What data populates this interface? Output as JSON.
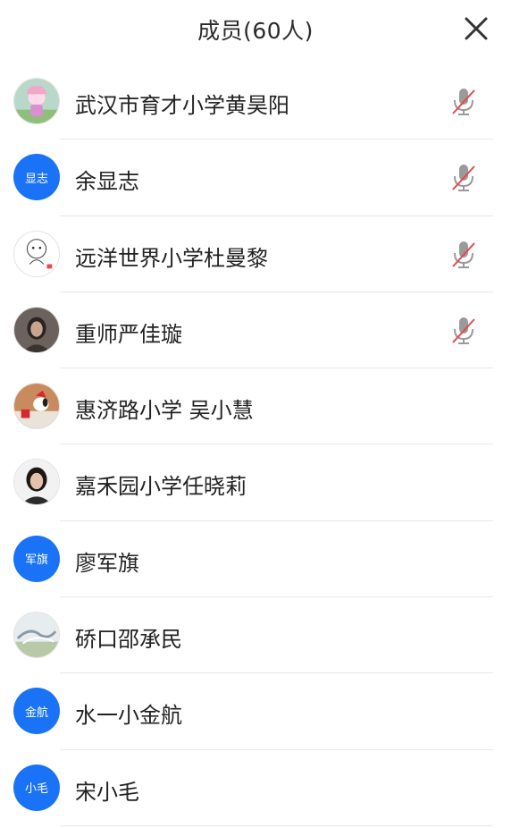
{
  "header": {
    "title": "成员(60人)",
    "close_icon": "close-icon"
  },
  "members": [
    {
      "name": "武汉市育才小学黄昊阳",
      "avatar_type": "photo",
      "avatar_icon": "cartoon-avatar-icon",
      "muted": true
    },
    {
      "name": "余显志",
      "avatar_type": "text",
      "avatar_text": "显志",
      "muted": true
    },
    {
      "name": "远洋世界小学杜曼黎",
      "avatar_type": "photo",
      "avatar_icon": "sketch-avatar-icon",
      "muted": true
    },
    {
      "name": "重师严佳璇",
      "avatar_type": "photo",
      "avatar_icon": "portrait-avatar-icon",
      "muted": true
    },
    {
      "name": "惠济路小学 吴小慧",
      "avatar_type": "photo",
      "avatar_icon": "snoopy-avatar-icon",
      "muted": false
    },
    {
      "name": "嘉禾园小学任晓莉",
      "avatar_type": "photo",
      "avatar_icon": "portrait-avatar-icon",
      "muted": false
    },
    {
      "name": "廖军旗",
      "avatar_type": "text",
      "avatar_text": "军旗",
      "muted": false
    },
    {
      "name": "硚口邵承民",
      "avatar_type": "photo",
      "avatar_icon": "landscape-avatar-icon",
      "muted": false
    },
    {
      "name": "水一小金航",
      "avatar_type": "text",
      "avatar_text": "金航",
      "muted": false
    },
    {
      "name": "宋小毛",
      "avatar_type": "text",
      "avatar_text": "小毛",
      "muted": false
    }
  ],
  "colors": {
    "accent": "#1a73f7",
    "muted_slash": "#e5484d",
    "mic_gray": "#9a9a9a"
  }
}
